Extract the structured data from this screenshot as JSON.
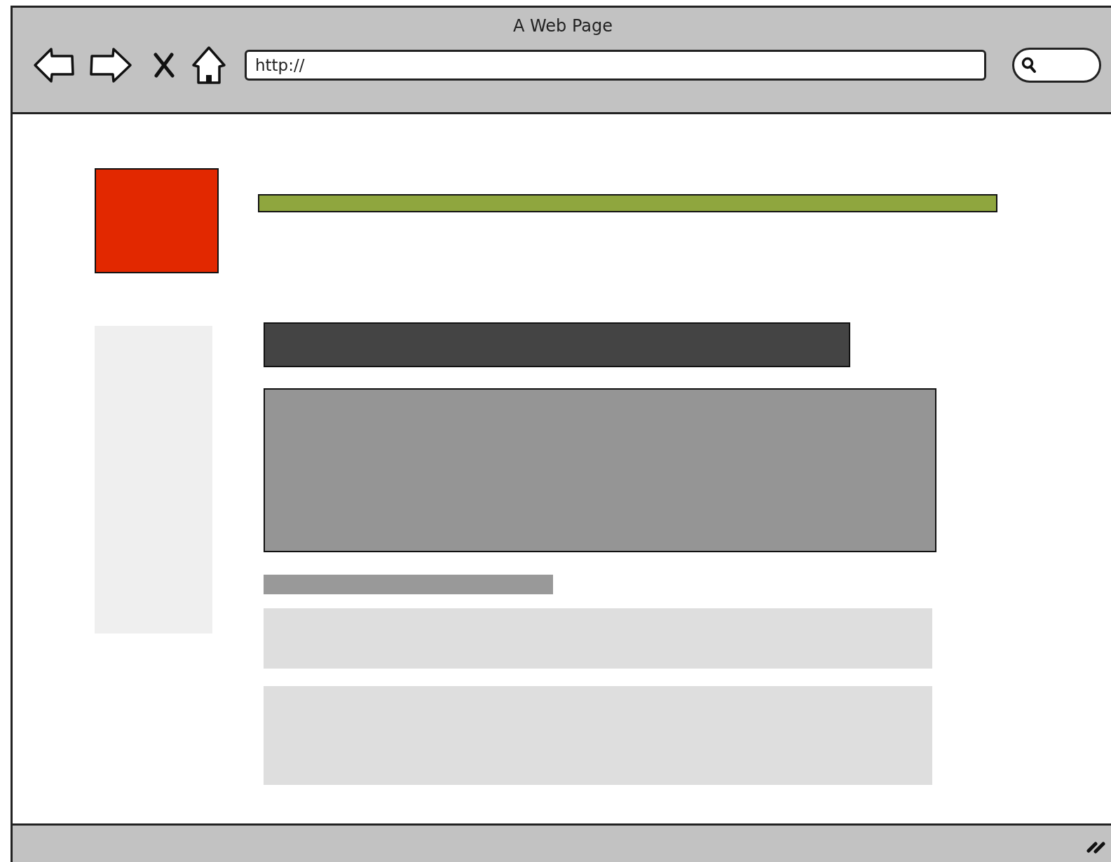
{
  "window": {
    "title": "A Web Page"
  },
  "address_bar": {
    "value": "http://"
  }
}
